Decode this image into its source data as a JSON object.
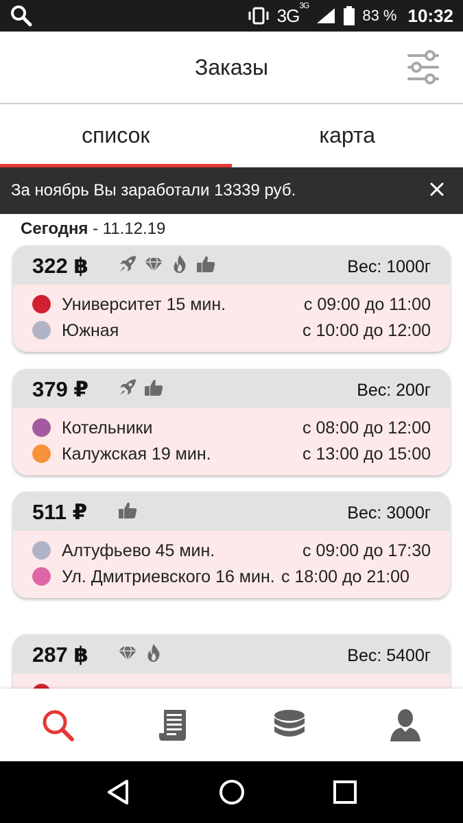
{
  "status_bar": {
    "network": "3G",
    "network_sup": "3G",
    "battery_pct": "83 %",
    "time": "10:32"
  },
  "app_bar": {
    "title": "Заказы",
    "filter_icon": "sliders-icon"
  },
  "tabs": [
    {
      "label": "список",
      "active": true
    },
    {
      "label": "карта",
      "active": false
    }
  ],
  "banner": {
    "text": "За ноябрь Вы заработали 13339 руб.",
    "close_icon": "close-icon"
  },
  "date_header": {
    "label": "Сегодня",
    "separator": " - ",
    "date": "11.12.19"
  },
  "colors": {
    "accent": "#e53935",
    "card_bg": "#fde9e9",
    "card_head_bg": "#e2e2e2",
    "red": "#d32030",
    "grey": "#b0b3c6",
    "purple": "#a45a9e",
    "orange": "#f7923a",
    "pink": "#e066a8"
  },
  "orders": [
    {
      "price": "322 ฿",
      "icons": [
        "rocket-icon",
        "diamond-icon",
        "fire-icon",
        "thumbs-up-icon"
      ],
      "weight": "Вес: 1000г",
      "stops": [
        {
          "name": "Университет 15 мин.",
          "time": "с 09:00 до 11:00",
          "color": "#d32030"
        },
        {
          "name": "Южная",
          "time": "с 10:00 до 12:00",
          "color": "#b0b3c6"
        }
      ]
    },
    {
      "price": "379 ₽",
      "icons": [
        "rocket-icon",
        "thumbs-up-icon"
      ],
      "weight": "Вес: 200г",
      "stops": [
        {
          "name": "Котельники",
          "time": "с 08:00 до 12:00",
          "color": "#a45a9e"
        },
        {
          "name": "Калужская 19 мин.",
          "time": "с 13:00 до 15:00",
          "color": "#f7923a"
        }
      ]
    },
    {
      "price": "511 ₽",
      "icons": [
        "thumbs-up-icon"
      ],
      "weight": "Вес: 3000г",
      "stops": [
        {
          "name": "Алтуфьево 45 мин.",
          "time": "с 09:00 до 17:30",
          "color": "#b0b3c6"
        },
        {
          "name": "Ул. Дмитриевского 16 мин.",
          "time": "с 18:00 до 21:00",
          "color": "#e066a8"
        }
      ]
    },
    {
      "price": "287 ฿",
      "icons": [
        "diamond-icon",
        "fire-icon"
      ],
      "weight": "Вес: 5400г",
      "stops": [
        {
          "name": "",
          "time": "",
          "color": "#d32030"
        }
      ]
    }
  ],
  "bottom_nav": [
    {
      "icon": "search-icon",
      "active": true
    },
    {
      "icon": "receipt-icon",
      "active": false
    },
    {
      "icon": "coins-icon",
      "active": false
    },
    {
      "icon": "user-icon",
      "active": false
    }
  ],
  "system_nav": [
    "back-icon",
    "home-icon",
    "recents-icon"
  ]
}
